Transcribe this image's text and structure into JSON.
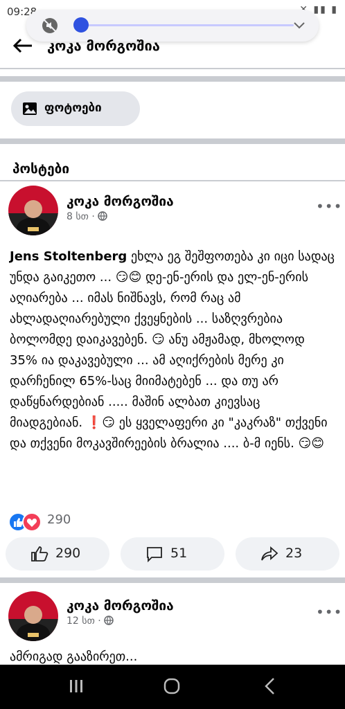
{
  "status_bar": {
    "time": "09:28",
    "icons": "✕ ▮▮ ▮"
  },
  "page": {
    "title": "კოკა მორგოშია"
  },
  "photos_button": {
    "label": "ფოტოები"
  },
  "posts_section": {
    "title": "პოსტები"
  },
  "posts": [
    {
      "author": "კოკა მორგოშია",
      "time": "8 სთ",
      "mention": "Jens Stoltenberg",
      "text": " ეხლა ეგ შეშფოთება კი იცი სადაც უნდა გაიკეთო ... 😏😊 დე-ენ-ერის და ელ-ენ-ერის აღიარება ... იმას ნიშნავს, რომ რაც ამ ახლადაღიარებული ქვეყნების ... საზღვრებია ბოლომდე დაიკავებენ. 😏 ანუ ამჟამად, მხოლოდ 35% ია დაკავებული ... ამ აღიქრების მერე კი დარჩენილ 65%-საც მიიმატებენ ... და თუ არ დაწყნარდებიან ..... მაშინ ალბათ კიევსაც მიადგებიან. ❗😏 ეს ყველაფერი კი \"კაკრაზ\" თქვენი და თქვენი მოკავშირეების ბრალია .... ბ-მ იენს. 😏😊",
      "reactions_count": "290",
      "like_count": "290",
      "comment_count": "51",
      "share_count": "23"
    },
    {
      "author": "კოკა მორგოშია",
      "time": "12 სთ",
      "snippet": "ამრიგად გააზირეთ..."
    }
  ],
  "icons": [
    "mute-icon",
    "chevron-down-icon",
    "back-arrow-icon",
    "photo-icon",
    "globe-icon",
    "more-icon",
    "like-icon",
    "comment-icon",
    "share-icon",
    "recents-icon",
    "home-icon",
    "nav-back-icon"
  ],
  "colors": {
    "accent": "#1877f2",
    "love": "#f33e58",
    "button_bg": "#e4e6eb",
    "volume_knob": "#2f52e0"
  }
}
